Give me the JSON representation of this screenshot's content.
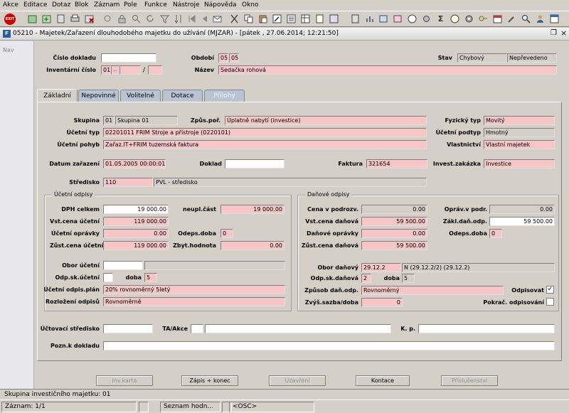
{
  "menu": [
    "Akce",
    "Editace",
    "Dotaz",
    "Blok",
    "Záznam",
    "Pole",
    "Funkce",
    "Nástroje",
    "Nápověda",
    "Okno"
  ],
  "toolbar": {
    "exit": "EXIT",
    "sigma": "Σ"
  },
  "window": {
    "title": "05210 - Majetek/Zařazení dlouhodobého majetku do užívání (MJZAR) - [pátek , 27.06.2014; 12:21:50]",
    "nav": "Nav"
  },
  "header": {
    "cislo_dokladu_label": "Číslo dokladu",
    "cislo_dokladu": "",
    "obdobi_label": "Období",
    "obdobi_1": "05",
    "obdobi_2": "05",
    "stav_label": "Stav",
    "stav_1": "Chybový",
    "stav_2": "Nepřevedeno",
    "inv_cislo_label": "Inventární číslo",
    "inv_cislo_1": "01",
    "inv_cislo_sep": "/",
    "inv_cislo_dots": "...",
    "nazev_label": "Název",
    "nazev": "Sedačka rohová"
  },
  "tabs": [
    "Základní",
    "Nepovinné",
    "Volitelné",
    "Dotace",
    "Přílohy"
  ],
  "main": {
    "skupina_label": "Skupina",
    "skupina_kod": "01",
    "skupina_nazev": "Skupina 01",
    "zpusob_label": "Způs.poř.",
    "zpusob": "Úplatně nabytí (investice)",
    "fyz_typ_label": "Fyzický typ",
    "fyz_typ": "Movitý",
    "uc_typ_label": "Účetní typ",
    "uc_typ": "02201011 FRIM Stroje a přístroje (0220101)",
    "uc_podtyp_label": "Účetní podtyp",
    "uc_podtyp": "Hmotný",
    "uc_pohyb_label": "Účetní pohyb",
    "uc_pohyb": "Zařaz.IT+FRIM tuzemská faktura",
    "vlastnictvi_label": "Vlastnictví",
    "vlastnictvi": "Vlastní majetek",
    "datum_label": "Datum zařazení",
    "datum": "01.05.2005 00:00:01",
    "doklad_label": "Doklad",
    "doklad": "",
    "faktura_label": "Faktura",
    "faktura": "321654",
    "invest_label": "Invest.zakázka",
    "invest": "Investice",
    "stredisko_label": "Středisko",
    "stredisko_kod": "110",
    "stredisko_nazev": "PVL - středisko"
  },
  "ucetni": {
    "title": "Účetní odpisy",
    "dph_label": "DPH celkem",
    "dph": "19 000.00",
    "neupl_label": "neupl.část",
    "neupl": "19 000.00",
    "vst_label": "Vst.cena účetní",
    "vst": "119 000.00",
    "opravky_label": "Účetní oprávky",
    "opravky": "0.00",
    "odeps_label": "Odeps.doba",
    "odeps": "0",
    "zust_label": "Zůst.cena účetní",
    "zust": "119 000.00",
    "zbyt_label": "Zbyt.hodnota",
    "zbyt": "0.00",
    "obor_label": "Obor účetní",
    "obor": "",
    "odpsk_label": "Odp.sk.účetní",
    "odpsk": "",
    "doba_label": "doba",
    "doba": "5",
    "plan_label": "Účetní odpis.plán",
    "plan": "20% rovnoměrný 5letý",
    "rozlozeni_label": "Rozložení odpisů",
    "rozlozeni": "Rovnoměrně"
  },
  "danove": {
    "title": "Daňové odpisy",
    "cena_label": "Cena v podrozv.",
    "cena": "0.00",
    "oprav_label": "Opráv.v podr.",
    "oprav": "0.00",
    "vst_label": "Vst.cena daňová",
    "vst": "59 500.00",
    "zakl_label": "Zákl.daň.odp.",
    "zakl": "59 500.00",
    "opravky_label": "Daňové oprávky",
    "opravky": "0.00",
    "odeps_label": "Odeps.doba",
    "odeps": "0",
    "zust_label": "Zůst.cena daňová",
    "zust": "59 500.00",
    "obor_label": "Obor daňový",
    "obor_kod": "29.12.2",
    "obor_text": "N (29.12.2/2) (29.12.2)",
    "odpsk_label": "Odp.sk.daňová",
    "odpsk": "2",
    "doba_label": "doba",
    "doba": "5",
    "zpusob_label": "Způsob daň.odp.",
    "zpusob": "Rovnoměrný",
    "odpisovat_label": "Odpisovat",
    "odpisovat_mark": "✓",
    "zvys_label": "Zvýš.sazba/doba",
    "zvys": "0",
    "pokrac_label": "Pokrač. odpisování"
  },
  "footer": {
    "uc_stredisko_label": "Účtovací středisko",
    "ta_label": "TA/Akce",
    "kp_label": "K. p.",
    "pozn_label": "Pozn.k dokladu"
  },
  "buttons": [
    "Inv.karta",
    "Zápis + konec",
    "Uzavření",
    "Kontace",
    "Příslušenství"
  ],
  "status": {
    "message": "Skupina investičního majetku: 01",
    "zaznam": "Záznam: 1/1",
    "seznam": "Seznam hodn...",
    "osc": "<OSC>"
  },
  "colors": {
    "required": "#f7c6c6",
    "tab_inactive": "#b8c4d4"
  }
}
